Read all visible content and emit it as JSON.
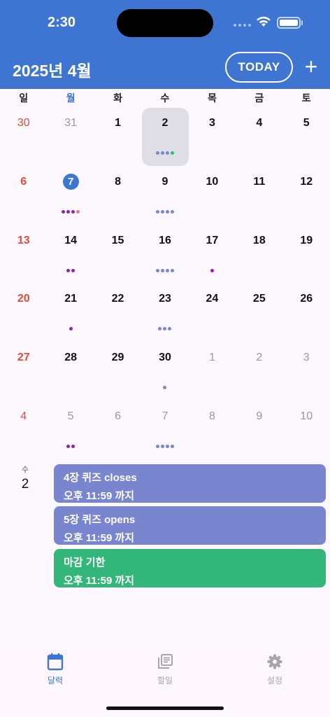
{
  "status_bar": {
    "time": "2:30"
  },
  "header": {
    "month_title": "2025년 4월",
    "today_label": "TODAY",
    "add_label": "+"
  },
  "weekdays": [
    "일",
    "월",
    "화",
    "수",
    "목",
    "금",
    "토"
  ],
  "calendar": {
    "weeks": [
      [
        {
          "day": "30",
          "other": true,
          "sun": true
        },
        {
          "day": "31",
          "other": true
        },
        {
          "day": "1"
        },
        {
          "day": "2",
          "selected": true,
          "dots": [
            "#7a85cf",
            "#7a85cf",
            "#7a85cf",
            "#34b67a"
          ]
        },
        {
          "day": "3"
        },
        {
          "day": "4"
        },
        {
          "day": "5"
        }
      ],
      [
        {
          "day": "6",
          "sun": true
        },
        {
          "day": "7",
          "today": true,
          "dots": [
            "#8e24aa",
            "#8e24aa",
            "#8e24aa",
            "#e67c73"
          ]
        },
        {
          "day": "8"
        },
        {
          "day": "9",
          "dots": [
            "#7a85cf",
            "#7a85cf",
            "#7a85cf",
            "#7a85cf"
          ]
        },
        {
          "day": "10"
        },
        {
          "day": "11"
        },
        {
          "day": "12"
        }
      ],
      [
        {
          "day": "13",
          "sun": true
        },
        {
          "day": "14",
          "dots": [
            "#8e24aa",
            "#8e24aa"
          ]
        },
        {
          "day": "15"
        },
        {
          "day": "16",
          "dots": [
            "#7a85cf",
            "#7a85cf",
            "#7a85cf",
            "#7a85cf"
          ]
        },
        {
          "day": "17",
          "dots": [
            "#8e24aa"
          ]
        },
        {
          "day": "18"
        },
        {
          "day": "19"
        }
      ],
      [
        {
          "day": "20",
          "sun": true
        },
        {
          "day": "21",
          "dots": [
            "#8e24aa"
          ]
        },
        {
          "day": "22"
        },
        {
          "day": "23",
          "dots": [
            "#7a85cf",
            "#7a85cf",
            "#7a85cf"
          ]
        },
        {
          "day": "24"
        },
        {
          "day": "25"
        },
        {
          "day": "26"
        }
      ],
      [
        {
          "day": "27",
          "sun": true
        },
        {
          "day": "28"
        },
        {
          "day": "29"
        },
        {
          "day": "30",
          "dots": [
            "#7a85cf"
          ]
        },
        {
          "day": "1",
          "other": true
        },
        {
          "day": "2",
          "other": true
        },
        {
          "day": "3",
          "other": true
        }
      ],
      [
        {
          "day": "4",
          "other": true,
          "sun": true
        },
        {
          "day": "5",
          "other": true,
          "dots": [
            "#8e24aa",
            "#8e24aa"
          ]
        },
        {
          "day": "6",
          "other": true
        },
        {
          "day": "7",
          "other": true,
          "dots": [
            "#7a85cf",
            "#7a85cf",
            "#7a85cf",
            "#7a85cf"
          ]
        },
        {
          "day": "8",
          "other": true
        },
        {
          "day": "9",
          "other": true
        },
        {
          "day": "10",
          "other": true
        }
      ]
    ]
  },
  "agenda": {
    "weekday": "수",
    "day": "2",
    "events": [
      {
        "title": "4장 퀴즈 closes",
        "time": "오후 11:59 까지",
        "color": "#7a85cf"
      },
      {
        "title": "5장 퀴즈 opens",
        "time": "오후 11:59 까지",
        "color": "#7a85cf"
      },
      {
        "title": "마감 기한",
        "time": "오후 11:59 까지",
        "color": "#33b679"
      }
    ]
  },
  "tabs": [
    {
      "label": "달력",
      "icon": "calendar-icon",
      "active": true
    },
    {
      "label": "할일",
      "icon": "library-books-icon",
      "active": false
    },
    {
      "label": "설정",
      "icon": "gear-icon",
      "active": false
    }
  ],
  "colors": {
    "accent": "#3e75d3",
    "sunday": "#e24a3b",
    "inactive": "#a6a6a6"
  }
}
